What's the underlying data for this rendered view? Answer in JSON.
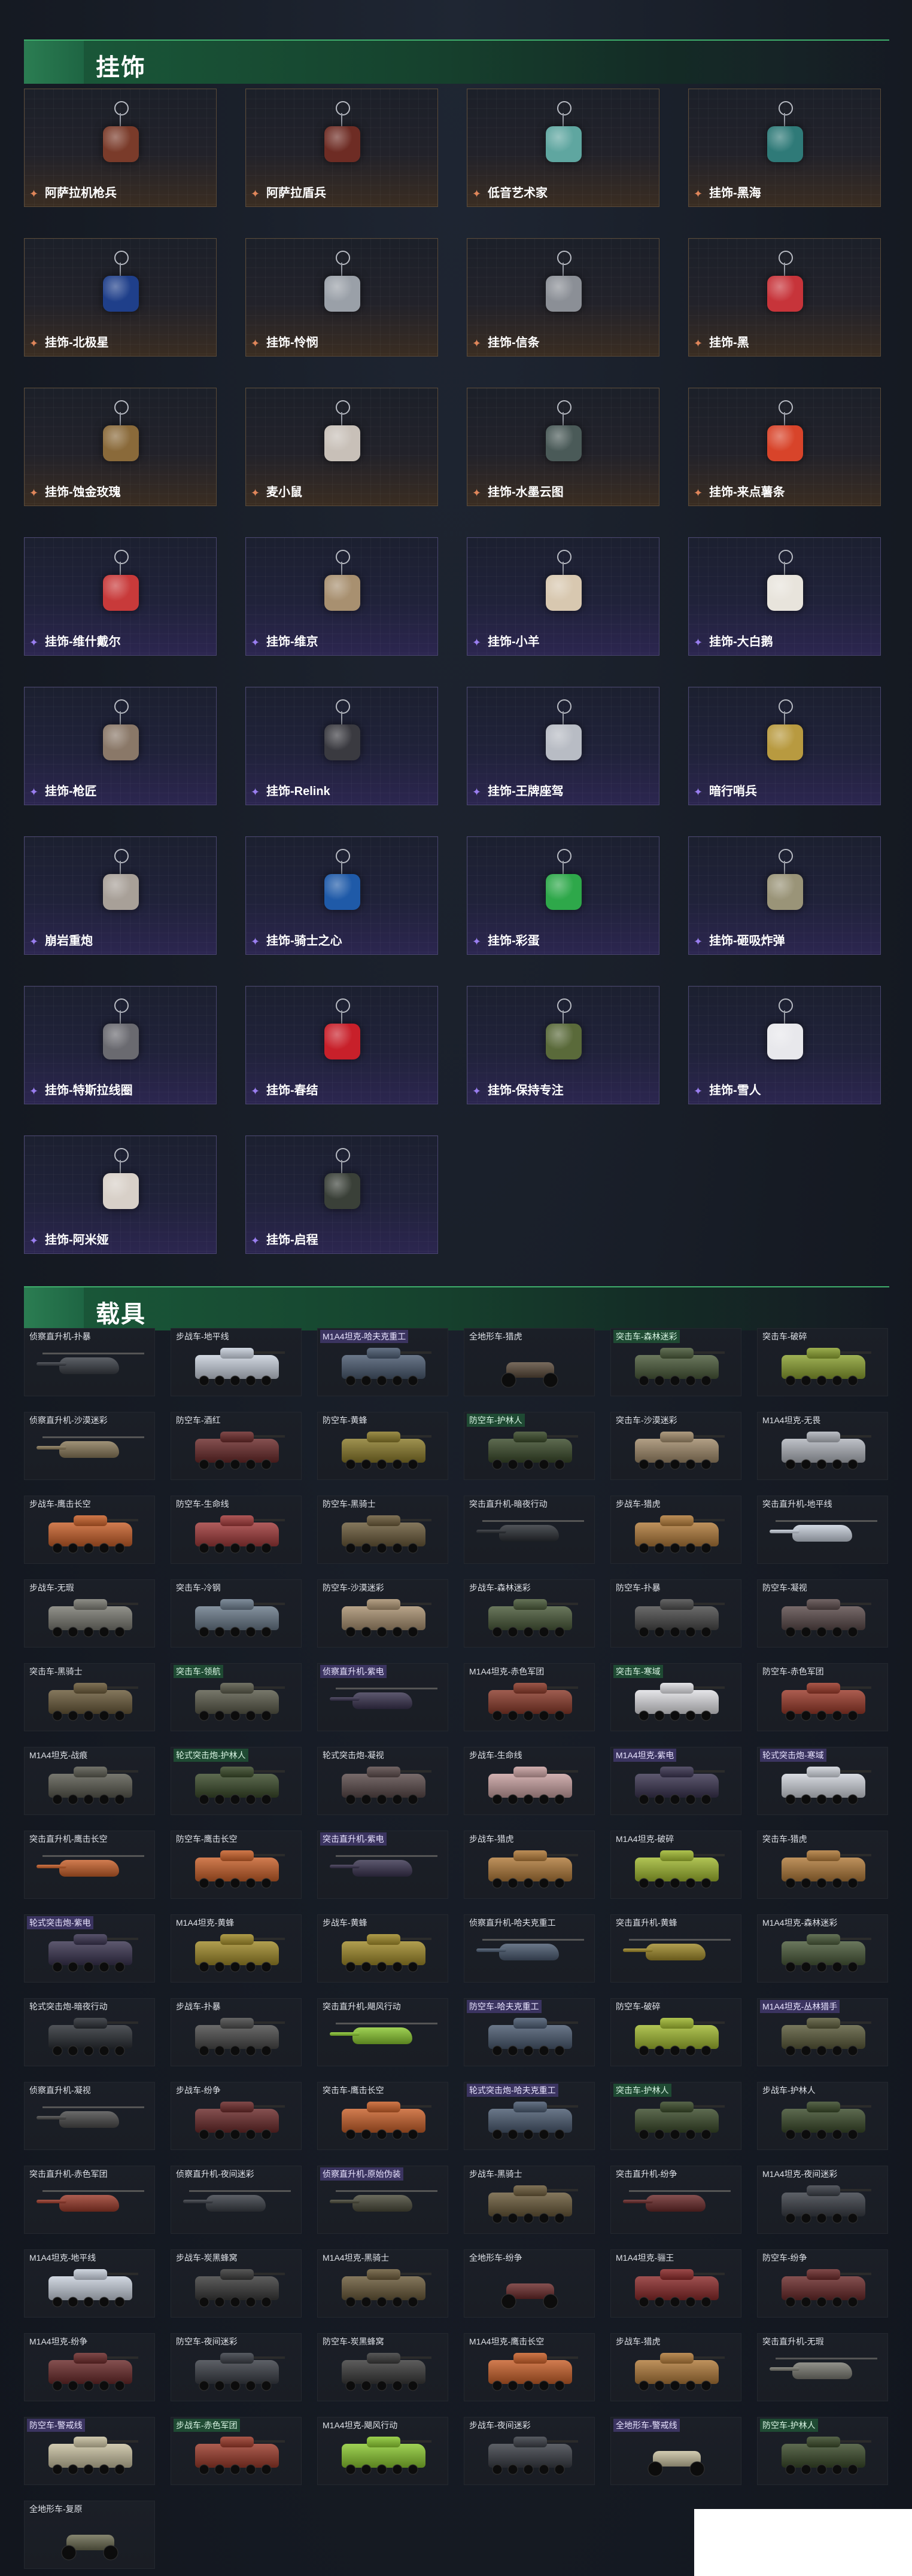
{
  "sections": {
    "charms_title": "挂饰",
    "vehicles_title": "载具"
  },
  "charms": [
    {
      "name": "阿萨拉机枪兵",
      "rarity": "gold",
      "color": "#7a3b2a"
    },
    {
      "name": "阿萨拉盾兵",
      "rarity": "gold",
      "color": "#6e2c24"
    },
    {
      "name": "低音艺术家",
      "rarity": "gold",
      "color": "#5fa6a0"
    },
    {
      "name": "挂饰-黑海",
      "rarity": "gold",
      "color": "#2f7a78"
    },
    {
      "name": "挂饰-北极星",
      "rarity": "gold",
      "color": "#1f3f8a"
    },
    {
      "name": "挂饰-怜悯",
      "rarity": "gold",
      "color": "#9aa0a8"
    },
    {
      "name": "挂饰-信条",
      "rarity": "gold",
      "color": "#8b8f96"
    },
    {
      "name": "挂饰-黑",
      "rarity": "gold",
      "color": "#c7343a"
    },
    {
      "name": "挂饰-蚀金玫瑰",
      "rarity": "gold",
      "color": "#8a6a3a"
    },
    {
      "name": "麦小鼠",
      "rarity": "gold",
      "color": "#c8c0b8"
    },
    {
      "name": "挂饰-水墨云图",
      "rarity": "gold",
      "color": "#4a5a58"
    },
    {
      "name": "挂饰-来点薯条",
      "rarity": "gold",
      "color": "#d8442a"
    },
    {
      "name": "挂饰-维什戴尔",
      "rarity": "purple",
      "color": "#c83a3a"
    },
    {
      "name": "挂饰-维京",
      "rarity": "purple",
      "color": "#a89070"
    },
    {
      "name": "挂饰-小羊",
      "rarity": "purple",
      "color": "#d8c8b0"
    },
    {
      "name": "挂饰-大白鹅",
      "rarity": "purple",
      "color": "#e8e4dc"
    },
    {
      "name": "挂饰-枪匠",
      "rarity": "purple",
      "color": "#8a7868"
    },
    {
      "name": "挂饰-Relink",
      "rarity": "purple",
      "color": "#3a3a40"
    },
    {
      "name": "挂饰-王牌座驾",
      "rarity": "purple",
      "color": "#b8bcc4"
    },
    {
      "name": "暗行哨兵",
      "rarity": "purple",
      "color": "#b89a40"
    },
    {
      "name": "崩岩重炮",
      "rarity": "purple",
      "color": "#a8a098"
    },
    {
      "name": "挂饰-骑士之心",
      "rarity": "purple",
      "color": "#1f5aa8"
    },
    {
      "name": "挂饰-彩蛋",
      "rarity": "purple",
      "color": "#2ea84a"
    },
    {
      "name": "挂饰-砸吸炸弹",
      "rarity": "purple",
      "color": "#9a9478"
    },
    {
      "name": "挂饰-特斯拉线圈",
      "rarity": "purple",
      "color": "#6a6a70"
    },
    {
      "name": "挂饰-春结",
      "rarity": "purple",
      "color": "#c8202a"
    },
    {
      "name": "挂饰-保持专注",
      "rarity": "purple",
      "color": "#5a6a3a"
    },
    {
      "name": "挂饰-雪人",
      "rarity": "purple",
      "color": "#e8e8ec"
    },
    {
      "name": "挂饰-阿米娅",
      "rarity": "purple",
      "color": "#d8d0c8"
    },
    {
      "name": "挂饰-启程",
      "rarity": "purple",
      "color": "#3a4038"
    }
  ],
  "vehicles": [
    {
      "name": "侦察直升机-扑暴",
      "kind": "heli",
      "color": "#3a3e46",
      "hl": ""
    },
    {
      "name": "步战车-地平线",
      "kind": "tank",
      "color": "#c8d0dc",
      "hl": ""
    },
    {
      "name": "M1A4坦克-哈夫克重工",
      "kind": "tank",
      "color": "#4a5a70",
      "hl": "purple"
    },
    {
      "name": "全地形车-猎虎",
      "kind": "atv",
      "color": "#5a4a3a",
      "hl": ""
    },
    {
      "name": "突击车-森林迷彩",
      "kind": "apc",
      "color": "#4a5a3a",
      "hl": "green"
    },
    {
      "name": "突击车-破碎",
      "kind": "apc",
      "color": "#8aa030",
      "hl": ""
    },
    {
      "name": "侦察直升机-沙漠迷彩",
      "kind": "heli",
      "color": "#8a7a5a",
      "hl": ""
    },
    {
      "name": "防空车-酒红",
      "kind": "apc",
      "color": "#6a2a2a",
      "hl": ""
    },
    {
      "name": "防空车-黄蜂",
      "kind": "apc",
      "color": "#8a7a2a",
      "hl": ""
    },
    {
      "name": "防空车-护林人",
      "kind": "apc",
      "color": "#3a4a2a",
      "hl": "green"
    },
    {
      "name": "突击车-沙漠迷彩",
      "kind": "apc",
      "color": "#a08a6a",
      "hl": ""
    },
    {
      "name": "M1A4坦克-无畏",
      "kind": "tank",
      "color": "#b0b4bc",
      "hl": ""
    },
    {
      "name": "步战车-鹰击长空",
      "kind": "apc",
      "color": "#c8602a",
      "hl": ""
    },
    {
      "name": "防空车-生命线",
      "kind": "apc",
      "color": "#a03a3a",
      "hl": ""
    },
    {
      "name": "防空车-黑骑士",
      "kind": "apc",
      "color": "#6a5a3a",
      "hl": ""
    },
    {
      "name": "突击直升机-暗夜行动",
      "kind": "heli",
      "color": "#2a2e34",
      "hl": ""
    },
    {
      "name": "步战车-猎虎",
      "kind": "apc",
      "color": "#b07a3a",
      "hl": ""
    },
    {
      "name": "突击直升机-地平线",
      "kind": "heli",
      "color": "#c8d0dc",
      "hl": ""
    },
    {
      "name": "步战车-无瑕",
      "kind": "apc",
      "color": "#7a7a72",
      "hl": ""
    },
    {
      "name": "突击车-冷钢",
      "kind": "apc",
      "color": "#6a7a8a",
      "hl": ""
    },
    {
      "name": "防空车-沙漠迷彩",
      "kind": "apc",
      "color": "#a89070",
      "hl": ""
    },
    {
      "name": "步战车-森林迷彩",
      "kind": "apc",
      "color": "#4a5a3a",
      "hl": ""
    },
    {
      "name": "防空车-扑暴",
      "kind": "apc",
      "color": "#4a4a4a",
      "hl": ""
    },
    {
      "name": "防空车-凝视",
      "kind": "apc",
      "color": "#5a4a4a",
      "hl": ""
    },
    {
      "name": "突击车-黑骑士",
      "kind": "apc",
      "color": "#6a5a3a",
      "hl": ""
    },
    {
      "name": "突击车-领航",
      "kind": "apc",
      "color": "#5a5a4a",
      "hl": "green"
    },
    {
      "name": "侦察直升机-紫电",
      "kind": "heli",
      "color": "#3a3450",
      "hl": "purple"
    },
    {
      "name": "M1A4坦克-赤色军团",
      "kind": "tank",
      "color": "#8a3a2a",
      "hl": ""
    },
    {
      "name": "突击车-寒域",
      "kind": "apc",
      "color": "#e0e0e4",
      "hl": "green"
    },
    {
      "name": "防空车-赤色军团",
      "kind": "apc",
      "color": "#9a3a2a",
      "hl": ""
    },
    {
      "name": "M1A4坦克-战痕",
      "kind": "tank",
      "color": "#5a5a50",
      "hl": ""
    },
    {
      "name": "轮式突击炮-护林人",
      "kind": "apc",
      "color": "#3a4a2a",
      "hl": "green"
    },
    {
      "name": "轮式突击炮-凝视",
      "kind": "apc",
      "color": "#5a4a4a",
      "hl": ""
    },
    {
      "name": "步战车-生命线",
      "kind": "apc",
      "color": "#c8a0a0",
      "hl": ""
    },
    {
      "name": "M1A4坦克-紫电",
      "kind": "tank",
      "color": "#3a3450",
      "hl": "purple"
    },
    {
      "name": "轮式突击炮-寒域",
      "kind": "apc",
      "color": "#d0d4dc",
      "hl": "purple"
    },
    {
      "name": "突击直升机-鹰击长空",
      "kind": "heli",
      "color": "#c8602a",
      "hl": ""
    },
    {
      "name": "防空车-鹰击长空",
      "kind": "apc",
      "color": "#c8602a",
      "hl": ""
    },
    {
      "name": "突击直升机-紫电",
      "kind": "heli",
      "color": "#3a3450",
      "hl": "purple"
    },
    {
      "name": "步战车-猎虎",
      "kind": "apc",
      "color": "#b07a3a",
      "hl": ""
    },
    {
      "name": "M1A4坦克-破碎",
      "kind": "tank",
      "color": "#a0b830",
      "hl": ""
    },
    {
      "name": "突击车-猎虎",
      "kind": "apc",
      "color": "#b07a3a",
      "hl": ""
    },
    {
      "name": "轮式突击炮-紫电",
      "kind": "apc",
      "color": "#3a3450",
      "hl": "purple"
    },
    {
      "name": "M1A4坦克-黄蜂",
      "kind": "tank",
      "color": "#a08a2a",
      "hl": ""
    },
    {
      "name": "步战车-黄蜂",
      "kind": "apc",
      "color": "#a08a2a",
      "hl": ""
    },
    {
      "name": "侦察直升机-哈夫克重工",
      "kind": "heli",
      "color": "#4a5a70",
      "hl": ""
    },
    {
      "name": "突击直升机-黄蜂",
      "kind": "heli",
      "color": "#a08a2a",
      "hl": ""
    },
    {
      "name": "M1A4坦克-森林迷彩",
      "kind": "tank",
      "color": "#4a5a3a",
      "hl": ""
    },
    {
      "name": "轮式突击炮-暗夜行动",
      "kind": "apc",
      "color": "#2a2e34",
      "hl": ""
    },
    {
      "name": "步战车-扑暴",
      "kind": "apc",
      "color": "#4a4a4a",
      "hl": ""
    },
    {
      "name": "突击直升机-飓风行动",
      "kind": "heli",
      "color": "#8ac830",
      "hl": ""
    },
    {
      "name": "防空车-哈夫克重工",
      "kind": "apc",
      "color": "#4a5a70",
      "hl": "purple"
    },
    {
      "name": "防空车-破碎",
      "kind": "apc",
      "color": "#a0b830",
      "hl": ""
    },
    {
      "name": "M1A4坦克-丛林猎手",
      "kind": "tank",
      "color": "#5a5a3a",
      "hl": "purple"
    },
    {
      "name": "侦察直升机-凝视",
      "kind": "heli",
      "color": "#4a4a4a",
      "hl": ""
    },
    {
      "name": "步战车-纷争",
      "kind": "apc",
      "color": "#6a2a2a",
      "hl": ""
    },
    {
      "name": "突击车-鹰击长空",
      "kind": "apc",
      "color": "#c8602a",
      "hl": ""
    },
    {
      "name": "轮式突击炮-哈夫克重工",
      "kind": "apc",
      "color": "#4a5a70",
      "hl": "purple"
    },
    {
      "name": "突击车-护林人",
      "kind": "apc",
      "color": "#3a4a2a",
      "hl": "green"
    },
    {
      "name": "步战车-护林人",
      "kind": "apc",
      "color": "#3a4a2a",
      "hl": ""
    },
    {
      "name": "突击直升机-赤色军团",
      "kind": "heli",
      "color": "#9a3a2a",
      "hl": ""
    },
    {
      "name": "侦察直升机-夜间迷彩",
      "kind": "heli",
      "color": "#3a3e46",
      "hl": ""
    },
    {
      "name": "侦察直升机-原始伪装",
      "kind": "heli",
      "color": "#4a4a3a",
      "hl": "purple"
    },
    {
      "name": "步战车-黑骑士",
      "kind": "apc",
      "color": "#6a5a3a",
      "hl": ""
    },
    {
      "name": "突击直升机-纷争",
      "kind": "heli",
      "color": "#6a2a2a",
      "hl": ""
    },
    {
      "name": "M1A4坦克-夜间迷彩",
      "kind": "tank",
      "color": "#3a3e46",
      "hl": ""
    },
    {
      "name": "M1A4坦克-地平线",
      "kind": "tank",
      "color": "#c8d0dc",
      "hl": ""
    },
    {
      "name": "步战车-炭黑蜂窝",
      "kind": "apc",
      "color": "#3a3a3a",
      "hl": ""
    },
    {
      "name": "M1A4坦克-黑骑士",
      "kind": "tank",
      "color": "#6a5a3a",
      "hl": ""
    },
    {
      "name": "全地形车-纷争",
      "kind": "atv",
      "color": "#6a2a2a",
      "hl": ""
    },
    {
      "name": "M1A4坦克-骊王",
      "kind": "tank",
      "color": "#8a2a2a",
      "hl": ""
    },
    {
      "name": "防空车-纷争",
      "kind": "apc",
      "color": "#6a2a2a",
      "hl": ""
    },
    {
      "name": "M1A4坦克-纷争",
      "kind": "tank",
      "color": "#6a2a2a",
      "hl": ""
    },
    {
      "name": "防空车-夜间迷彩",
      "kind": "apc",
      "color": "#3a3e46",
      "hl": ""
    },
    {
      "name": "防空车-炭黑蜂窝",
      "kind": "apc",
      "color": "#3a3a3a",
      "hl": ""
    },
    {
      "name": "M1A4坦克-鹰击长空",
      "kind": "tank",
      "color": "#c8602a",
      "hl": ""
    },
    {
      "name": "步战车-猎虎",
      "kind": "apc",
      "color": "#b07a3a",
      "hl": ""
    },
    {
      "name": "突击直升机-无瑕",
      "kind": "heli",
      "color": "#7a7a72",
      "hl": ""
    },
    {
      "name": "防空车-警戒线",
      "kind": "apc",
      "color": "#c8c0a0",
      "hl": "purple"
    },
    {
      "name": "步战车-赤色军团",
      "kind": "apc",
      "color": "#9a3a2a",
      "hl": "green"
    },
    {
      "name": "M1A4坦克-飓风行动",
      "kind": "tank",
      "color": "#8ac830",
      "hl": ""
    },
    {
      "name": "步战车-夜间迷彩",
      "kind": "apc",
      "color": "#3a3e46",
      "hl": ""
    },
    {
      "name": "全地形车-警戒线",
      "kind": "atv",
      "color": "#c8c0a0",
      "hl": "purple"
    },
    {
      "name": "防空车-护林人",
      "kind": "apc",
      "color": "#3a4a2a",
      "hl": "green"
    },
    {
      "name": "全地形车-复原",
      "kind": "atv",
      "color": "#6a6a50",
      "hl": ""
    }
  ]
}
